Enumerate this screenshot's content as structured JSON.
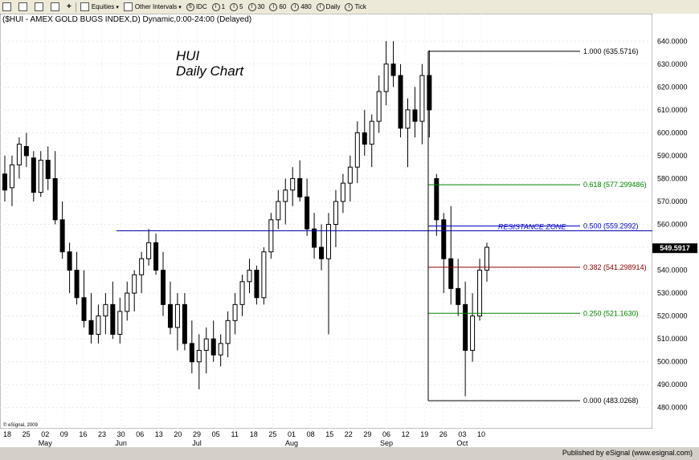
{
  "toolbar": {
    "equities_label": "Equities",
    "intervals_label": "Other Intervals",
    "items": [
      "IDC",
      "1",
      "5",
      "30",
      "60",
      "480",
      "Daily",
      "Tick"
    ]
  },
  "chart_data": {
    "type": "candlestick",
    "header": "($HUI - AMEX GOLD BUGS INDEX,D) Dynamic,0:00-24:00 (Delayed)",
    "annotation_title": "HUI",
    "annotation_subtitle": "Daily Chart",
    "credit": "© eSignal, 2009",
    "ylim": [
      475,
      645
    ],
    "yticks": [
      "640.0000",
      "630.0000",
      "620.0000",
      "610.0000",
      "600.0000",
      "590.0000",
      "580.0000",
      "570.0000",
      "560.0000",
      "550.0000",
      "540.0000",
      "530.0000",
      "520.0000",
      "510.0000",
      "500.0000",
      "490.0000",
      "480.0000"
    ],
    "x_day_labels": [
      "18",
      "25",
      "02",
      "09",
      "16",
      "23",
      "30",
      "06",
      "13",
      "20",
      "29",
      "05",
      "11",
      "18",
      "25",
      "01",
      "08",
      "15",
      "22",
      "29",
      "06",
      "12",
      "19",
      "26",
      "03",
      "10"
    ],
    "x_month_labels": [
      "May",
      "Jun",
      "Jul",
      "Aug",
      "Sep",
      "Oct"
    ],
    "last_price": "549.5917",
    "last_value": 549.59,
    "resistance_label": "RESISTANCE ZONE",
    "resistance_value": 557.2,
    "fib_levels": [
      {
        "label": "1.000 (635.5716)",
        "value": 635.5716,
        "color": "#000000"
      },
      {
        "label": "0.618 (577.299486)",
        "value": 577.299486,
        "color": "#008000"
      },
      {
        "label": "0.500 (559.2992)",
        "value": 559.2992,
        "color": "#0000cc"
      },
      {
        "label": "0.382 (541.298914)",
        "value": 541.298914,
        "color": "#8b0000"
      },
      {
        "label": "0.250 (521.1630)",
        "value": 521.163,
        "color": "#008000"
      },
      {
        "label": "0.000 (483.0268)",
        "value": 483.0268,
        "color": "#000000"
      }
    ],
    "candles": [
      [
        582,
        590,
        570,
        575
      ],
      [
        576,
        590,
        568,
        586
      ],
      [
        586,
        598,
        580,
        595
      ],
      [
        594,
        600,
        585,
        590
      ],
      [
        589,
        592,
        570,
        574
      ],
      [
        574,
        592,
        572,
        588
      ],
      [
        588,
        594,
        575,
        580
      ],
      [
        580,
        592,
        560,
        562
      ],
      [
        562,
        570,
        545,
        548
      ],
      [
        548,
        552,
        530,
        540
      ],
      [
        540,
        548,
        525,
        528
      ],
      [
        528,
        540,
        515,
        518
      ],
      [
        518,
        530,
        508,
        512
      ],
      [
        512,
        525,
        508,
        520
      ],
      [
        520,
        530,
        512,
        525
      ],
      [
        525,
        535,
        510,
        512
      ],
      [
        512,
        528,
        508,
        522
      ],
      [
        522,
        535,
        518,
        530
      ],
      [
        530,
        540,
        522,
        538
      ],
      [
        538,
        548,
        530,
        545
      ],
      [
        545,
        558,
        542,
        552
      ],
      [
        552,
        556,
        538,
        540
      ],
      [
        540,
        548,
        520,
        525
      ],
      [
        525,
        535,
        512,
        515
      ],
      [
        515,
        530,
        505,
        525
      ],
      [
        525,
        530,
        505,
        508
      ],
      [
        508,
        518,
        495,
        500
      ],
      [
        500,
        512,
        488,
        505
      ],
      [
        505,
        515,
        495,
        510
      ],
      [
        510,
        518,
        500,
        503
      ],
      [
        503,
        512,
        498,
        508
      ],
      [
        508,
        522,
        502,
        518
      ],
      [
        518,
        530,
        512,
        525
      ],
      [
        525,
        538,
        520,
        535
      ],
      [
        535,
        545,
        530,
        540
      ],
      [
        540,
        542,
        525,
        528
      ],
      [
        528,
        550,
        525,
        548
      ],
      [
        548,
        565,
        545,
        562
      ],
      [
        562,
        575,
        558,
        570
      ],
      [
        570,
        580,
        560,
        575
      ],
      [
        575,
        585,
        568,
        580
      ],
      [
        580,
        588,
        570,
        572
      ],
      [
        572,
        580,
        555,
        558
      ],
      [
        558,
        565,
        545,
        550
      ],
      [
        550,
        560,
        540,
        545
      ],
      [
        545,
        565,
        512,
        560
      ],
      [
        560,
        575,
        550,
        570
      ],
      [
        570,
        582,
        565,
        578
      ],
      [
        578,
        590,
        570,
        585
      ],
      [
        585,
        605,
        578,
        600
      ],
      [
        600,
        610,
        590,
        595
      ],
      [
        595,
        608,
        585,
        605
      ],
      [
        605,
        625,
        600,
        618
      ],
      [
        618,
        640,
        612,
        630
      ],
      [
        630,
        640,
        620,
        625
      ],
      [
        625,
        630,
        598,
        602
      ],
      [
        602,
        615,
        585,
        610
      ],
      [
        610,
        620,
        598,
        605
      ],
      [
        605,
        630,
        595,
        625
      ],
      [
        625,
        636,
        598,
        610
      ],
      [
        580,
        582,
        555,
        562
      ],
      [
        562,
        565,
        530,
        545
      ],
      [
        545,
        568,
        525,
        532
      ],
      [
        532,
        545,
        520,
        525
      ],
      [
        525,
        535,
        485,
        505
      ],
      [
        505,
        530,
        500,
        520
      ],
      [
        520,
        545,
        518,
        540
      ],
      [
        540,
        552,
        535,
        550
      ]
    ]
  }
}
